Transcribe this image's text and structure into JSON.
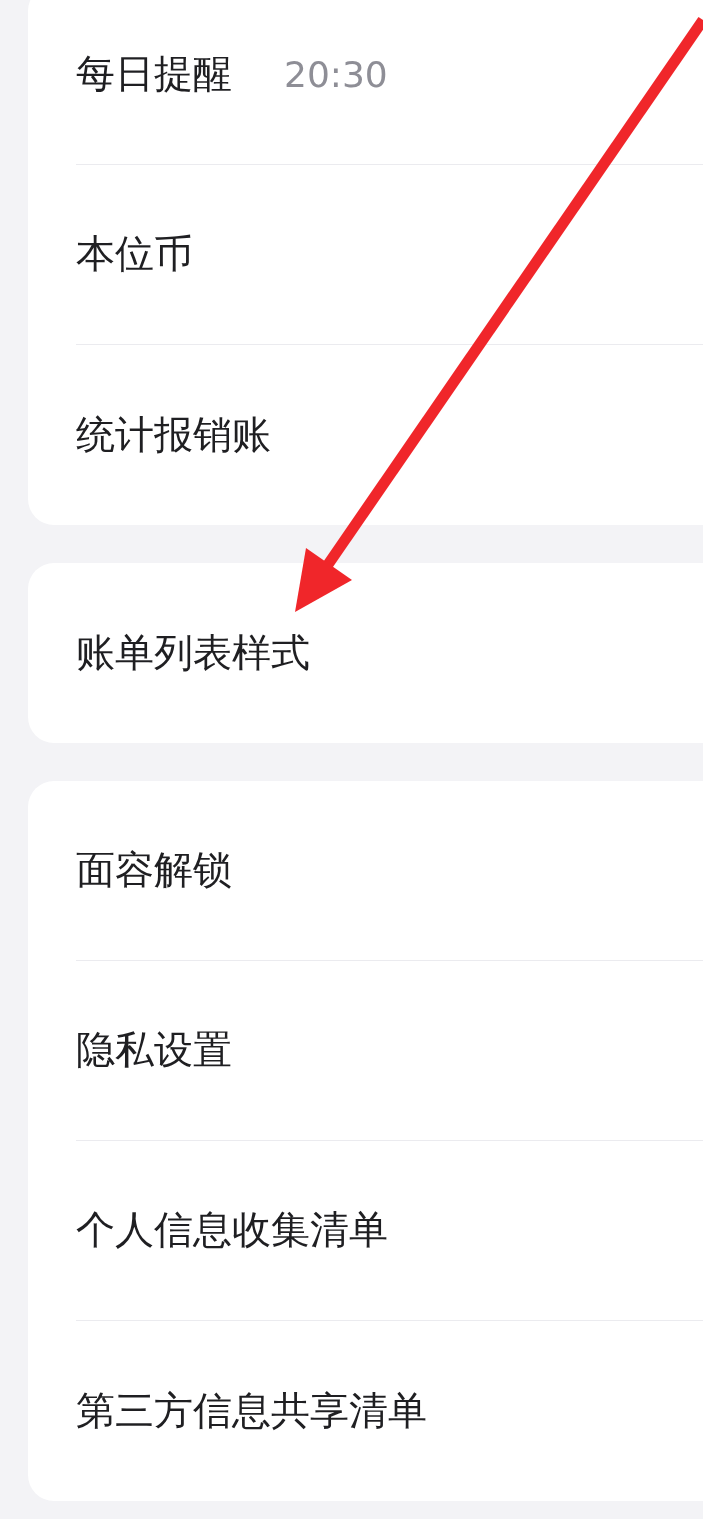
{
  "groups": [
    {
      "items": [
        {
          "label": "每日提醒",
          "value": "20:30"
        },
        {
          "label": "本位币"
        },
        {
          "label": "统计报销账"
        }
      ]
    },
    {
      "items": [
        {
          "label": "账单列表样式"
        }
      ]
    },
    {
      "items": [
        {
          "label": "面容解锁"
        },
        {
          "label": "隐私设置"
        },
        {
          "label": "个人信息收集清单"
        },
        {
          "label": "第三方信息共享清单"
        }
      ]
    }
  ]
}
